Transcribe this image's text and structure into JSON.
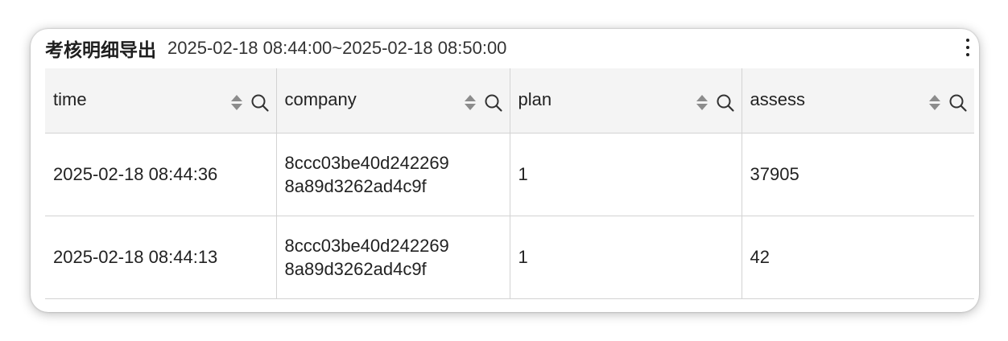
{
  "header": {
    "title": "考核明细导出",
    "time_range": "2025-02-18 08:44:00~2025-02-18 08:50:00"
  },
  "table": {
    "columns": [
      {
        "label": "time"
      },
      {
        "label": "company"
      },
      {
        "label": "plan"
      },
      {
        "label": "assess"
      }
    ],
    "rows": [
      {
        "time": "2025-02-18 08:44:36",
        "company_line1": "8ccc03be40d242269",
        "company_line2": "8a89d3262ad4c9f",
        "plan": "1",
        "assess": "37905"
      },
      {
        "time": "2025-02-18 08:44:13",
        "company_line1": "8ccc03be40d242269",
        "company_line2": "8a89d3262ad4c9f",
        "plan": "1",
        "assess": "42"
      }
    ]
  },
  "icons": {
    "sort": "sort-icon",
    "search": "search-icon",
    "more": "more-vertical-icon"
  },
  "colors": {
    "header_bg": "#f4f4f4",
    "border": "#d3d3d3",
    "icon": "#8c8c8c",
    "text": "#222222"
  }
}
